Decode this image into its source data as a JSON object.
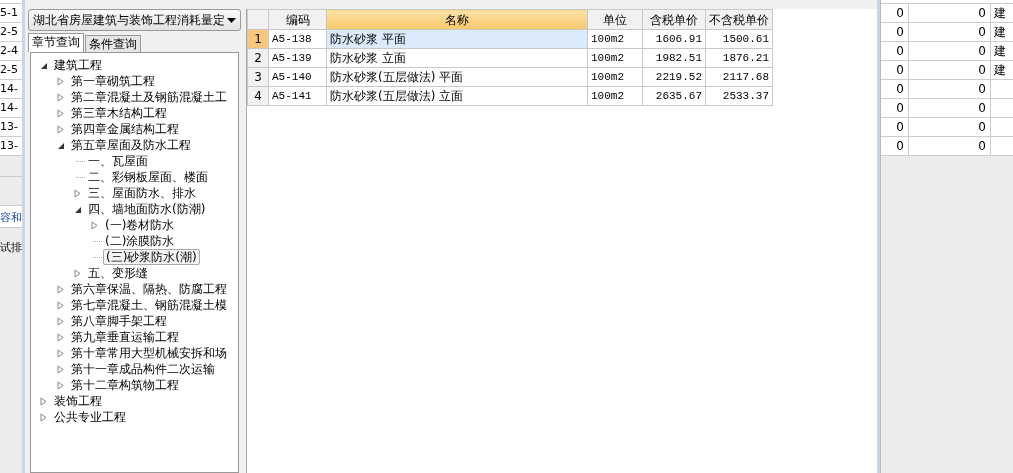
{
  "background_left": {
    "rows": [
      "5-1",
      "2-5",
      "2-4",
      "2-5",
      "14-",
      "14-",
      "13-",
      "13-"
    ],
    "link_text": "容和",
    "label_text": "试排"
  },
  "dialog": {
    "quota_select": {
      "value": "湖北省房屋建筑与装饰工程消耗量定"
    },
    "tabs": [
      {
        "label": "章节查询",
        "selected": true
      },
      {
        "label": "条件查询",
        "selected": false
      }
    ],
    "tree": [
      {
        "label": "建筑工程",
        "kind": "node",
        "expanded": true,
        "selected": false,
        "children": [
          {
            "label": "第一章砌筑工程",
            "kind": "node",
            "expanded": false,
            "selected": false
          },
          {
            "label": "第二章混凝土及钢筋混凝土工",
            "kind": "node",
            "expanded": false,
            "selected": false
          },
          {
            "label": "第三章木结构工程",
            "kind": "node",
            "expanded": false,
            "selected": false
          },
          {
            "label": "第四章金属结构工程",
            "kind": "node",
            "expanded": false,
            "selected": false
          },
          {
            "label": "第五章屋面及防水工程",
            "kind": "node",
            "expanded": true,
            "selected": false,
            "children": [
              {
                "label": "一、瓦屋面",
                "kind": "leaf",
                "selected": false
              },
              {
                "label": "二、彩钢板屋面、楼面",
                "kind": "leaf",
                "selected": false
              },
              {
                "label": "三、屋面防水、排水",
                "kind": "node",
                "expanded": false,
                "selected": false
              },
              {
                "label": "四、墙地面防水(防潮)",
                "kind": "node",
                "expanded": true,
                "selected": false,
                "children": [
                  {
                    "label": "(一)卷材防水",
                    "kind": "node",
                    "expanded": false,
                    "selected": false
                  },
                  {
                    "label": "(二)涂膜防水",
                    "kind": "leaf",
                    "selected": false
                  },
                  {
                    "label": "(三)砂浆防水(潮)",
                    "kind": "leaf",
                    "selected": true
                  }
                ]
              },
              {
                "label": "五、变形缝",
                "kind": "node",
                "expanded": false,
                "selected": false
              }
            ]
          },
          {
            "label": "第六章保温、隔热、防腐工程",
            "kind": "node",
            "expanded": false,
            "selected": false
          },
          {
            "label": "第七章混凝土、钢筋混凝土模",
            "kind": "node",
            "expanded": false,
            "selected": false
          },
          {
            "label": "第八章脚手架工程",
            "kind": "node",
            "expanded": false,
            "selected": false
          },
          {
            "label": "第九章垂直运输工程",
            "kind": "node",
            "expanded": false,
            "selected": false
          },
          {
            "label": "第十章常用大型机械安拆和场",
            "kind": "node",
            "expanded": false,
            "selected": false
          },
          {
            "label": "第十一章成品构件二次运输",
            "kind": "node",
            "expanded": false,
            "selected": false
          },
          {
            "label": "第十二章构筑物工程",
            "kind": "node",
            "expanded": false,
            "selected": false
          }
        ]
      },
      {
        "label": "装饰工程",
        "kind": "node",
        "expanded": false,
        "selected": false
      },
      {
        "label": "公共专业工程",
        "kind": "node",
        "expanded": false,
        "selected": false
      }
    ],
    "table": {
      "columns": [
        {
          "label": "编码",
          "selected": false
        },
        {
          "label": "名称",
          "selected": true
        },
        {
          "label": "单位",
          "selected": false
        },
        {
          "label": "含税单价",
          "selected": false
        },
        {
          "label": "不含税单价",
          "selected": false
        }
      ],
      "rows": [
        {
          "number": "1",
          "code": "A5-138",
          "name": "防水砂浆 平面",
          "unit": "100m2",
          "price_tax": "1606.91",
          "price_notax": "1500.61",
          "selected": true
        },
        {
          "number": "2",
          "code": "A5-139",
          "name": "防水砂浆 立面",
          "unit": "100m2",
          "price_tax": "1982.51",
          "price_notax": "1876.21",
          "selected": false
        },
        {
          "number": "3",
          "code": "A5-140",
          "name": "防水砂浆(五层做法) 平面",
          "unit": "100m2",
          "price_tax": "2219.52",
          "price_notax": "2117.68",
          "selected": false
        },
        {
          "number": "4",
          "code": "A5-141",
          "name": "防水砂浆(五层做法) 立面",
          "unit": "100m2",
          "price_tax": "2635.67",
          "price_notax": "2533.37",
          "selected": false
        }
      ]
    }
  },
  "background_right": {
    "rows": [
      {
        "column_1": "0",
        "column_2": "0",
        "column_3": "建"
      },
      {
        "column_1": "0",
        "column_2": "0",
        "column_3": "建"
      },
      {
        "column_1": "0",
        "column_2": "0",
        "column_3": "建"
      },
      {
        "column_1": "0",
        "column_2": "0",
        "column_3": "建"
      },
      {
        "column_1": "0",
        "column_2": "0"
      },
      {
        "column_1": "0",
        "column_2": "0"
      },
      {
        "column_1": "0",
        "column_2": "0"
      },
      {
        "column_1": "0",
        "column_2": "0"
      }
    ]
  }
}
